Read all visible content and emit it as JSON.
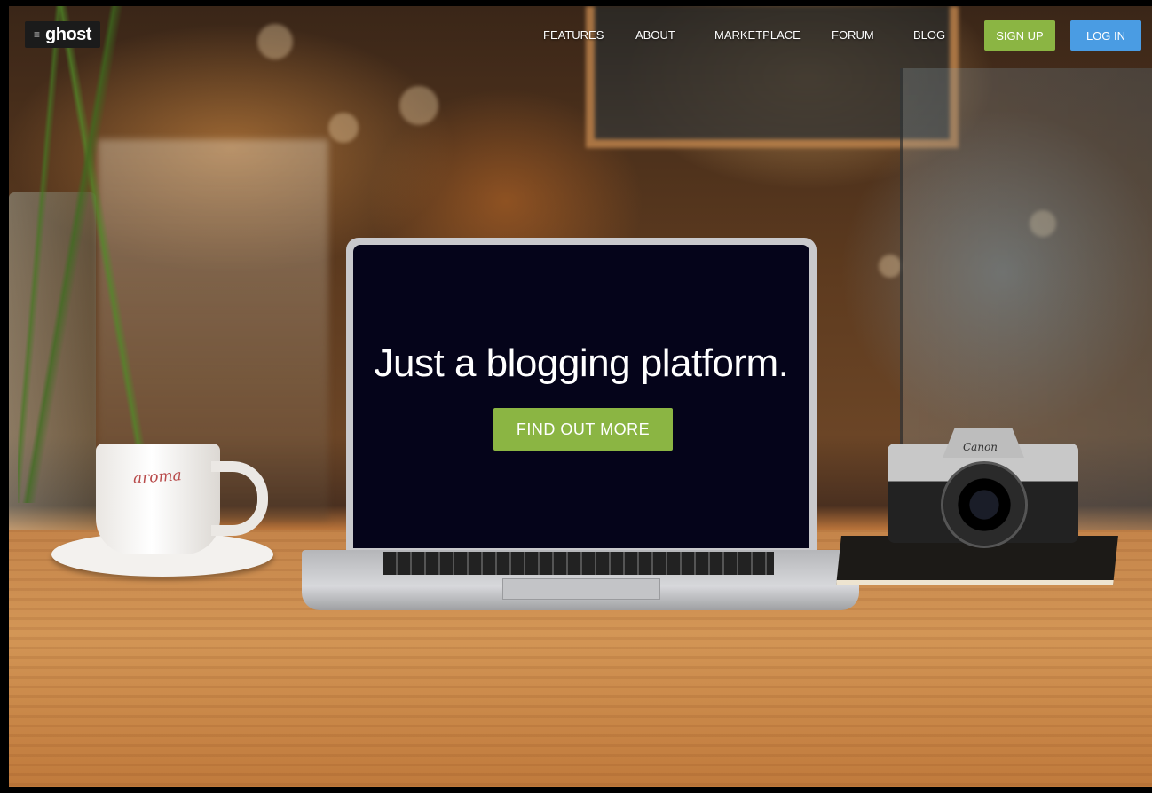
{
  "brand": {
    "name": "ghost",
    "icon": "menu-lines-icon"
  },
  "nav": {
    "items": [
      {
        "label": "FEATURES"
      },
      {
        "label": "ABOUT"
      },
      {
        "label": "MARKETPLACE"
      },
      {
        "label": "FORUM"
      },
      {
        "label": "BLOG"
      }
    ],
    "signup_label": "SIGN UP",
    "login_label": "LOG IN"
  },
  "hero": {
    "title": "Just a blogging platform.",
    "cta_label": "FIND OUT MORE"
  },
  "photo_props": {
    "cup_brand": "aroma",
    "camera_brand": "Canon"
  },
  "colors": {
    "signup_green": "#8bb543",
    "login_blue": "#4a9ce3",
    "cta_green": "#8bb543"
  }
}
